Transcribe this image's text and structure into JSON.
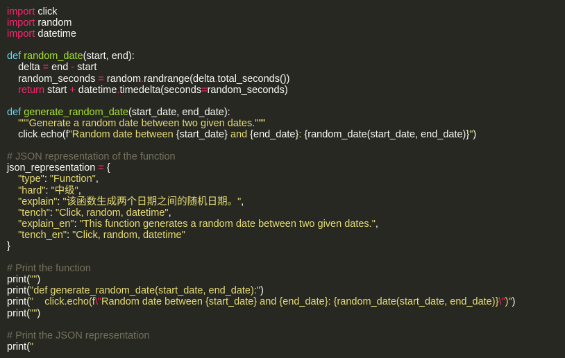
{
  "colors": {
    "background": "#272822",
    "keyword": "#F92672",
    "def_keyword": "#66D9EF",
    "function_name": "#A6E22E",
    "string": "#E6DB74",
    "comment": "#75715E",
    "plain": "#F8F8F2"
  },
  "lines": [
    [
      [
        "kw",
        "import"
      ],
      [
        "pl",
        " click"
      ]
    ],
    [
      [
        "kw",
        "import"
      ],
      [
        "pl",
        " random"
      ]
    ],
    [
      [
        "kw",
        "import"
      ],
      [
        "pl",
        " datetime"
      ]
    ],
    [],
    [
      [
        "dk",
        "def"
      ],
      [
        "pl",
        " "
      ],
      [
        "fn",
        "random_date"
      ],
      [
        "pl",
        "(start, end):"
      ]
    ],
    [
      [
        "pl",
        "    delta "
      ],
      [
        "op",
        "="
      ],
      [
        "pl",
        " end "
      ],
      [
        "op",
        "-"
      ],
      [
        "pl",
        " start"
      ]
    ],
    [
      [
        "pl",
        "    random_seconds "
      ],
      [
        "op",
        "="
      ],
      [
        "pl",
        " random"
      ],
      [
        "op",
        "."
      ],
      [
        "pl",
        "randrange(delta"
      ],
      [
        "op",
        "."
      ],
      [
        "pl",
        "total_seconds())"
      ]
    ],
    [
      [
        "pl",
        "    "
      ],
      [
        "kw",
        "return"
      ],
      [
        "pl",
        " start "
      ],
      [
        "op",
        "+"
      ],
      [
        "pl",
        " datetime"
      ],
      [
        "op",
        "."
      ],
      [
        "pl",
        "timedelta(seconds"
      ],
      [
        "op",
        "="
      ],
      [
        "pl",
        "random_seconds)"
      ]
    ],
    [],
    [
      [
        "dk",
        "def"
      ],
      [
        "pl",
        " "
      ],
      [
        "fn",
        "generate_random_date"
      ],
      [
        "pl",
        "(start_date, end_date):"
      ]
    ],
    [
      [
        "pl",
        "    "
      ],
      [
        "st",
        "\"\"\"Generate a random date between two given dates.\"\"\""
      ]
    ],
    [
      [
        "pl",
        "    click"
      ],
      [
        "op",
        "."
      ],
      [
        "pl",
        "echo(f"
      ],
      [
        "st",
        "\"Random date between "
      ],
      [
        "pl",
        "{start_date}"
      ],
      [
        "st",
        " and "
      ],
      [
        "pl",
        "{end_date}"
      ],
      [
        "st",
        ": "
      ],
      [
        "pl",
        "{random_date(start_date, end_date)}"
      ],
      [
        "st",
        "\""
      ],
      [
        "pl",
        ")"
      ]
    ],
    [],
    [
      [
        "cm",
        "# JSON representation of the function"
      ]
    ],
    [
      [
        "pl",
        "json_representation "
      ],
      [
        "op",
        "="
      ],
      [
        "pl",
        " {"
      ]
    ],
    [
      [
        "pl",
        "    "
      ],
      [
        "st",
        "\"type\""
      ],
      [
        "pl",
        ": "
      ],
      [
        "st",
        "\"Function\""
      ],
      [
        "pl",
        ","
      ]
    ],
    [
      [
        "pl",
        "    "
      ],
      [
        "st",
        "\"hard\""
      ],
      [
        "pl",
        ": "
      ],
      [
        "st",
        "\"中级\""
      ],
      [
        "pl",
        ","
      ]
    ],
    [
      [
        "pl",
        "    "
      ],
      [
        "st",
        "\"explain\""
      ],
      [
        "pl",
        ": "
      ],
      [
        "st",
        "\"该函数生成两个日期之间的随机日期。\""
      ],
      [
        "pl",
        ","
      ]
    ],
    [
      [
        "pl",
        "    "
      ],
      [
        "st",
        "\"tench\""
      ],
      [
        "pl",
        ": "
      ],
      [
        "st",
        "\"Click, random, datetime\""
      ],
      [
        "pl",
        ","
      ]
    ],
    [
      [
        "pl",
        "    "
      ],
      [
        "st",
        "\"explain_en\""
      ],
      [
        "pl",
        ": "
      ],
      [
        "st",
        "\"This function generates a random date between two given dates.\""
      ],
      [
        "pl",
        ","
      ]
    ],
    [
      [
        "pl",
        "    "
      ],
      [
        "st",
        "\"tench_en\""
      ],
      [
        "pl",
        ": "
      ],
      [
        "st",
        "\"Click, random, datetime\""
      ]
    ],
    [
      [
        "pl",
        "}"
      ]
    ],
    [],
    [
      [
        "cm",
        "# Print the function"
      ]
    ],
    [
      [
        "pl",
        "print("
      ],
      [
        "st",
        "\"\""
      ],
      [
        "pl",
        ")"
      ]
    ],
    [
      [
        "pl",
        "print("
      ],
      [
        "st",
        "\"def generate_random_date(start_date, end_date):\""
      ],
      [
        "pl",
        ")"
      ]
    ],
    [
      [
        "pl",
        "print("
      ],
      [
        "st",
        "\"    click.echo(f"
      ],
      [
        "op",
        "\\\""
      ],
      [
        "st",
        "Random date between {start_date} and {end_date}: {random_date(start_date, end_date)}"
      ],
      [
        "op",
        "\\\""
      ],
      [
        "st",
        ")\""
      ],
      [
        "pl",
        ")"
      ]
    ],
    [
      [
        "pl",
        "print("
      ],
      [
        "st",
        "\"\""
      ],
      [
        "pl",
        ")"
      ]
    ],
    [],
    [
      [
        "cm",
        "# Print the JSON representation"
      ]
    ],
    [
      [
        "pl",
        "print("
      ],
      [
        "st",
        "\""
      ]
    ]
  ]
}
